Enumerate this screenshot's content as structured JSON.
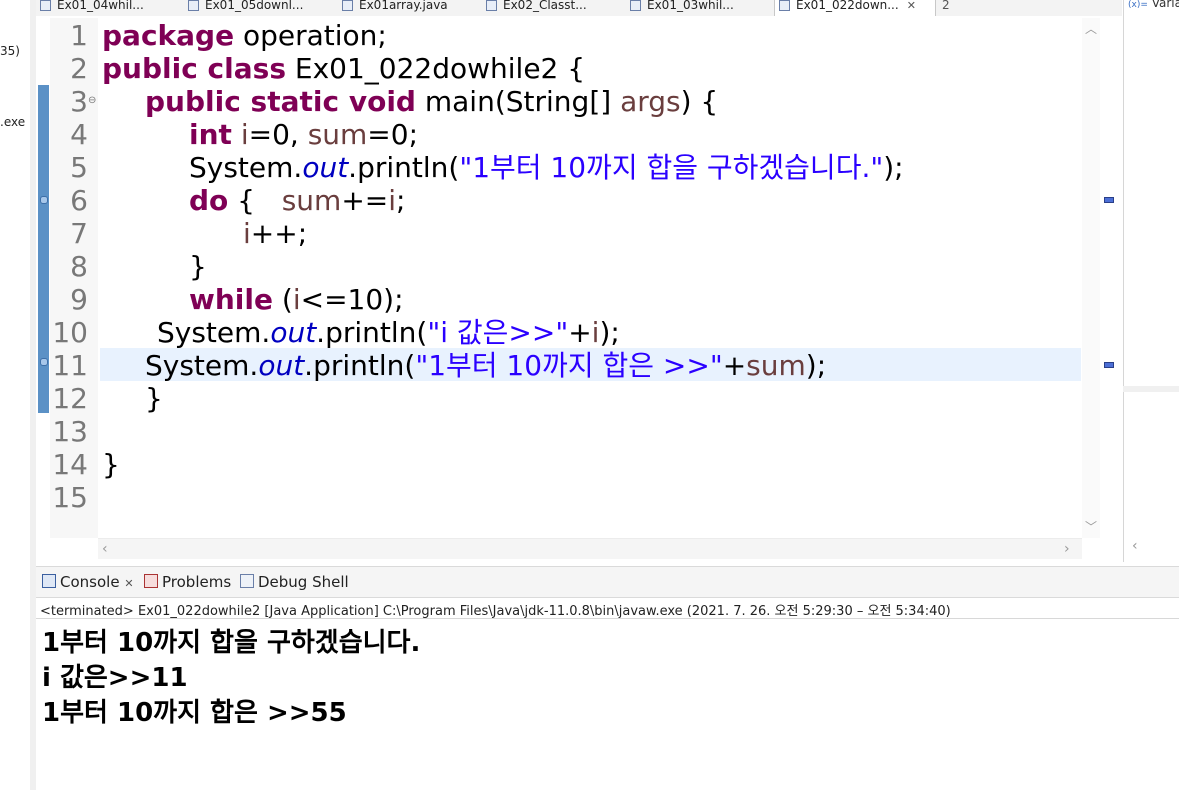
{
  "left_panel": {
    "lines": [
      "35)",
      ".exe"
    ]
  },
  "editor_tabs": [
    {
      "label": "Ex01_04whil..."
    },
    {
      "label": "Ex01_05downl..."
    },
    {
      "label": "Ex01array.java"
    },
    {
      "label": "Ex02_Classt..."
    },
    {
      "label": "Ex01_03whil..."
    },
    {
      "label": "Ex01_022down...",
      "close": "✕"
    },
    {
      "label": "2"
    }
  ],
  "right_panel": {
    "label": "Varia"
  },
  "line_numbers": [
    "1",
    "2",
    "3",
    "4",
    "5",
    "6",
    "7",
    "8",
    "9",
    "10",
    "11",
    "12",
    "13",
    "14",
    "15"
  ],
  "code": {
    "l1_kw": "package",
    "l1_rest": " operation;",
    "l2_kw": "public class",
    "l2_rest": " Ex01_022dowhile2 {",
    "l3_kw": "public static void",
    "l3_a": " main(String[] ",
    "l3_var": "args",
    "l3_b": ") {",
    "l4_kw": "int",
    "l4_rest": " ",
    "l4_v1": "i",
    "l4_m": "=0, ",
    "l4_v2": "sum",
    "l4_e": "=0;",
    "l5_a": "System.",
    "l5_fld": "out",
    "l5_b": ".println(",
    "l5_str": "\"1부터 10까지 합을 구하겠습니다.\"",
    "l5_c": ");",
    "l6_kw": "do",
    "l6_a": " {   ",
    "l6_var": "sum",
    "l6_b": "+=",
    "l6_v2": "i",
    "l6_c": ";",
    "l7_var": "i",
    "l7_rest": "++;",
    "l8": "}",
    "l9_kw": "while",
    "l9_a": " (",
    "l9_var": "i",
    "l9_b": "<=10);",
    "l10_a": "System.",
    "l10_fld": "out",
    "l10_b": ".println(",
    "l10_str": "\"i 값은>>\"",
    "l10_c": "+",
    "l10_var": "i",
    "l10_d": ");",
    "l11_a": "System.",
    "l11_fld": "out",
    "l11_b": ".println(",
    "l11_str": "\"1부터 10까지 합은 >>\"",
    "l11_c": "+",
    "l11_var": "sum",
    "l11_d": ");",
    "l12": "}",
    "l14": "}"
  },
  "console": {
    "tabs": [
      {
        "label": "Console",
        "close": "✕"
      },
      {
        "label": "Problems"
      },
      {
        "label": "Debug Shell"
      }
    ],
    "status": "<terminated> Ex01_022dowhile2 [Java Application] C:\\Program Files\\Java\\jdk-11.0.8\\bin\\javaw.exe  (2021. 7. 26. 오전 5:29:30 – 오전 5:34:40)",
    "output": [
      "1부터 10까지 합을 구하겠습니다.",
      "i 값은>>11",
      "1부터 10까지 합은 >>55"
    ]
  },
  "colors": {
    "keyword": "#7f0055",
    "string": "#2a00ff",
    "field": "#0000c0",
    "local_var": "#6a3e3e",
    "current_line": "#e8f2fe"
  }
}
